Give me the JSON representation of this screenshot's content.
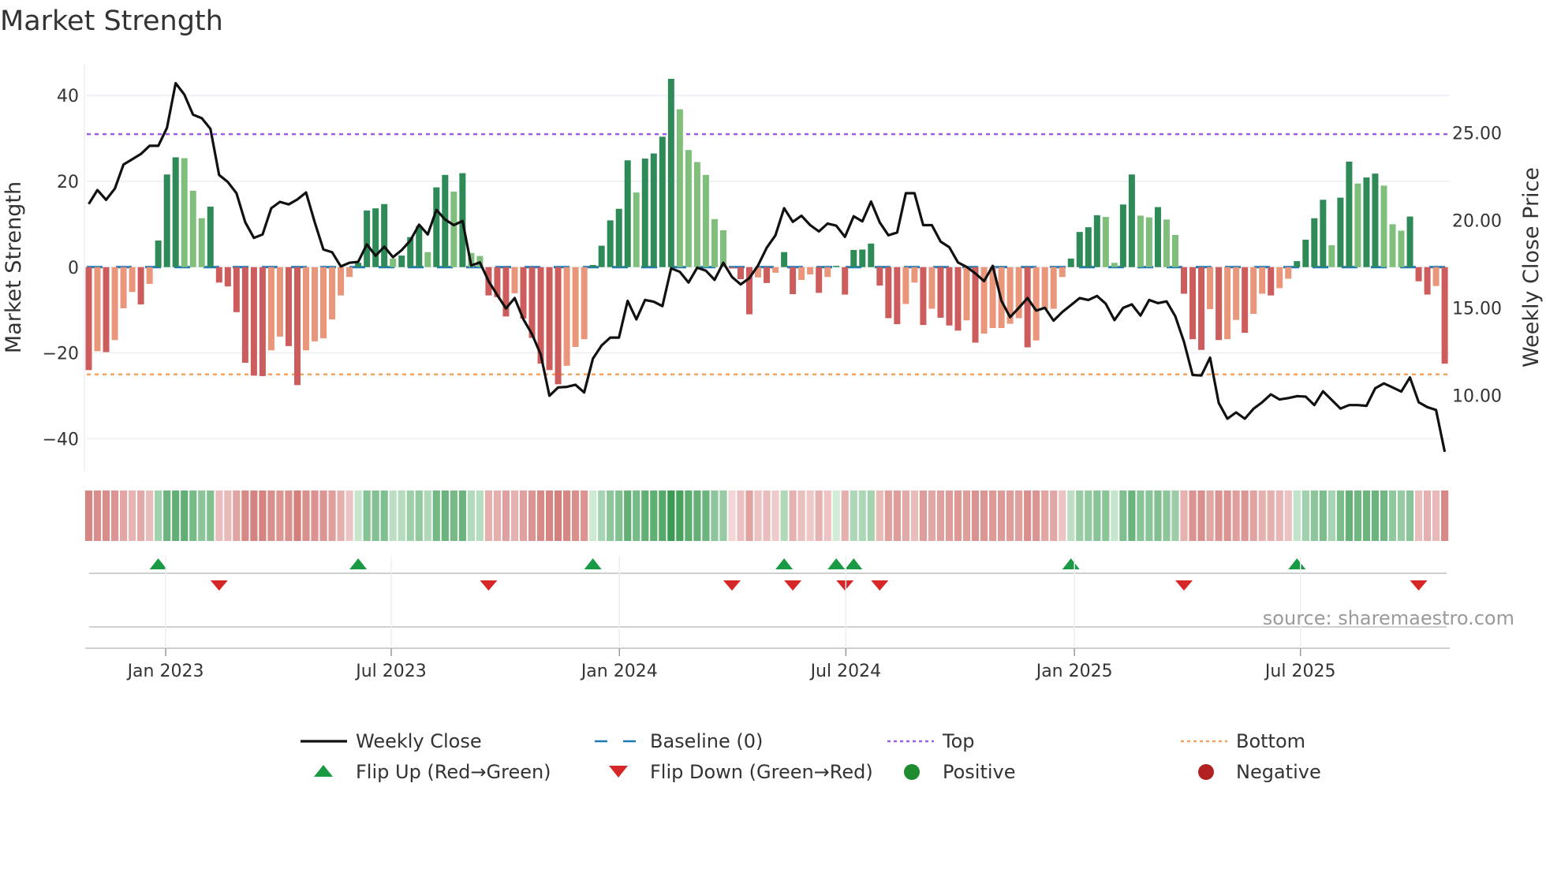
{
  "title": "Market Strength",
  "source": "source: sharemaestro.com",
  "colors": {
    "up_strong": "#2e8b57",
    "up_weak": "#7fbf7b",
    "down_strong": "#cd5c5c",
    "down_weak": "#e9967a",
    "baseline": "#1f77b4",
    "top": "#9b5de5",
    "bottom": "#f4a460",
    "close": "#111111",
    "flip_up": "#1a9a44",
    "flip_down": "#d62728",
    "positive": "#1e8c2e",
    "negative": "#b22222"
  },
  "legend": [
    {
      "label": "Weekly Close",
      "symbol": "line"
    },
    {
      "label": "Baseline (0)",
      "symbol": "dash"
    },
    {
      "label": "Top",
      "symbol": "dot-purple"
    },
    {
      "label": "Bottom",
      "symbol": "dot-orange"
    },
    {
      "label": "Flip Up (Red→Green)",
      "symbol": "triangle-up"
    },
    {
      "label": "Flip Down (Green→Red)",
      "symbol": "triangle-down"
    },
    {
      "label": "Positive",
      "symbol": "circle-green"
    },
    {
      "label": "Negative",
      "symbol": "circle-red"
    }
  ],
  "chart_data": {
    "type": "bar",
    "title": "Market Strength",
    "ylabel": "Market Strength",
    "y2label": "Weekly Close Price",
    "ylim": [
      -47.5,
      47.5
    ],
    "y2lim": [
      5.64,
      28.96
    ],
    "yticks": [
      40,
      20,
      0,
      -20,
      -40
    ],
    "yticklabels": [
      "40",
      "20",
      "0",
      "−20",
      "−40"
    ],
    "y2ticks": [
      25,
      20,
      15,
      10
    ],
    "y2ticklabels": [
      "25.00",
      "20.00",
      "15.00",
      "10.00"
    ],
    "xticks": [
      {
        "label": "Jan 2023",
        "week": 8.85
      },
      {
        "label": "Jul 2023",
        "week": 34.8
      },
      {
        "label": "Jan 2024",
        "week": 61.05
      },
      {
        "label": "Jul 2024",
        "week": 87.1
      },
      {
        "label": "Jan 2025",
        "week": 113.4
      },
      {
        "label": "Jul 2025",
        "week": 139.4
      }
    ],
    "baseline": 0,
    "top_level": 31,
    "bottom_level": -25,
    "strength": [
      -24,
      -19.6,
      -19.8,
      -17,
      -9.6,
      -5.8,
      -8.7,
      -3.9,
      6.2,
      21.6,
      25.6,
      25.4,
      17.8,
      11.4,
      14.1,
      -3.6,
      -4.5,
      -10.5,
      -22.3,
      -25.3,
      -25.4,
      -19.4,
      -16.2,
      -18.4,
      -27.5,
      -19.4,
      -17.3,
      -16.6,
      -12.2,
      -6.6,
      -2.3,
      1,
      13.2,
      13.7,
      14.7,
      2,
      2.7,
      7,
      9.6,
      3.5,
      18.6,
      21.5,
      17.6,
      21.9,
      3.3,
      2.6,
      -6.6,
      -7,
      -11.5,
      -6.1,
      -12,
      -16.5,
      -22.5,
      -24,
      -27.3,
      -23,
      -18.6,
      -16.8,
      0.5,
      5,
      10.9,
      13.6,
      24.9,
      17.4,
      25.3,
      26.5,
      30.4,
      43.9,
      36.8,
      27.3,
      24.5,
      21.5,
      11.2,
      8.6,
      -0.3,
      -2.8,
      -11,
      -2.4,
      -3.7,
      -1.3,
      3.5,
      -6.3,
      -3,
      -1.7,
      -6,
      -2.3,
      0.3,
      -6.4,
      4,
      4.1,
      5.5,
      -4.3,
      -11.9,
      -13.3,
      -8.6,
      -3.6,
      -13.5,
      -9.7,
      -11.8,
      -13.6,
      -14.8,
      -12.4,
      -17.6,
      -15.5,
      -14.2,
      -14.2,
      -13.2,
      -11.9,
      -18.7,
      -17.1,
      -9.8,
      -9.7,
      -2.3,
      2,
      8.2,
      9.3,
      12.1,
      11.7,
      1,
      14.6,
      21.6,
      12,
      11.6,
      14,
      11.1,
      7.5,
      -6.2,
      -16.8,
      -19.3,
      -9.8,
      -17,
      -16.8,
      -12.3,
      -15.3,
      -10.9,
      -6.2,
      -6.6,
      -4.9,
      -2.7,
      1.4,
      6.4,
      11.4,
      15.7,
      5.1,
      16.2,
      24.6,
      19.5,
      20.9,
      21.8,
      19,
      10,
      8.5,
      11.8,
      -3.3,
      -6.4,
      -4.4,
      -22.5
    ],
    "weekly_close": [
      20.94,
      21.74,
      21.18,
      21.82,
      23.2,
      23.5,
      23.8,
      24.27,
      24.27,
      25.3,
      27.85,
      27.2,
      26.05,
      25.85,
      25.24,
      22.6,
      22.2,
      21.56,
      19.9,
      19.0,
      19.2,
      20.7,
      21.06,
      20.92,
      21.2,
      21.6,
      19.9,
      18.34,
      18.18,
      17.37,
      17.58,
      17.63,
      18.63,
      17.98,
      18.5,
      17.9,
      18.3,
      18.85,
      19.76,
      19.2,
      20.6,
      20.05,
      19.73,
      19.97,
      17.42,
      17.6,
      16.53,
      15.73,
      14.97,
      15.56,
      14.35,
      13.5,
      12.34,
      9.97,
      10.45,
      10.48,
      10.6,
      10.16,
      12.1,
      12.85,
      13.3,
      13.3,
      15.4,
      14.34,
      15.45,
      15.35,
      15.1,
      17.26,
      17.06,
      16.45,
      17.3,
      17.13,
      16.6,
      17.58,
      16.77,
      16.34,
      16.7,
      17.42,
      18.44,
      19.15,
      20.7,
      19.92,
      20.27,
      19.73,
      19.37,
      19.82,
      19.7,
      19.06,
      20.24,
      19.95,
      21.08,
      19.89,
      19.15,
      19.31,
      21.56,
      21.56,
      19.73,
      19.73,
      18.79,
      18.47,
      17.6,
      17.34,
      16.97,
      16.53,
      17.4,
      15.4,
      14.47,
      15.0,
      15.56,
      14.84,
      15.0,
      14.27,
      14.76,
      15.16,
      15.56,
      15.45,
      15.68,
      15.24,
      14.3,
      15.0,
      15.2,
      14.56,
      15.45,
      15.27,
      15.37,
      14.52,
      13.06,
      11.16,
      11.13,
      12.15,
      9.56,
      8.66,
      9.02,
      8.66,
      9.23,
      9.6,
      10.05,
      9.76,
      9.84,
      9.95,
      9.92,
      9.44,
      10.23,
      9.73,
      9.24,
      9.44,
      9.44,
      9.4,
      10.4,
      10.68,
      10.45,
      10.21,
      11.02,
      9.6,
      9.32,
      9.16,
      6.77
    ],
    "legend_placement": "bottom-center",
    "grid": true
  }
}
